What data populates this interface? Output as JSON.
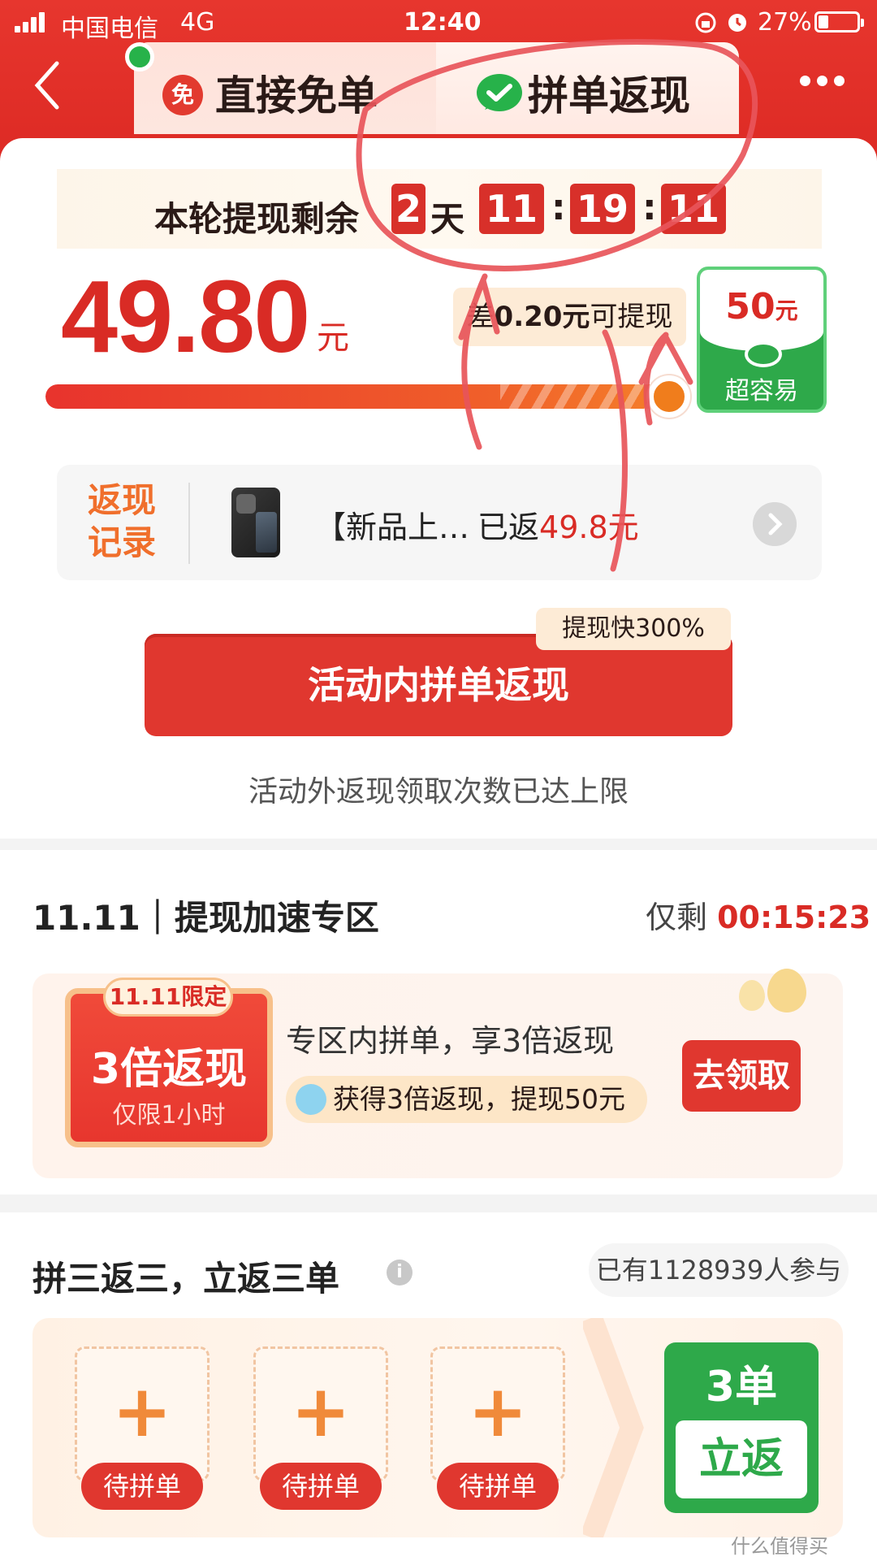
{
  "status_bar": {
    "carrier": "中国电信",
    "network": "4G",
    "time": "12:40",
    "battery": "27%",
    "battery_level": 0.27
  },
  "tabs": [
    {
      "badge": "免",
      "label": "直接免单"
    },
    {
      "label": "拼单返现"
    }
  ],
  "countdown": {
    "prefix": "本轮提现剩余",
    "days": "2",
    "day_unit": "天",
    "hours": "11",
    "minutes": "19",
    "seconds": "11"
  },
  "balance": {
    "amount": "49.80",
    "unit": "元",
    "need_prefix": "差",
    "need_amount": "0.20元",
    "need_suffix": "可提现",
    "target_amount": "50",
    "target_unit": "元",
    "target_sub": "超容易",
    "progress": 0.996
  },
  "record": {
    "title_line1": "返现",
    "title_line2": "记录",
    "product_name": "【新品上…",
    "status_prefix": "已返",
    "status_amount": "49.8元"
  },
  "speed_tip": "提现快300%",
  "main_button": "活动内拼单返现",
  "limit_note": "活动外返现领取次数已达上限",
  "zone": {
    "title": "11.11｜提现加速专区",
    "remain_label": "仅剩",
    "remain_time": "00:15:23",
    "promo_tag": "11.11限定",
    "promo_main": "3倍返现",
    "promo_sub": "仅限1小时",
    "desc": "专区内拼单，享3倍返现",
    "pill": "获得3倍返现，提现50元",
    "button": "去领取"
  },
  "team": {
    "title": "拼三返三，立返三单",
    "count": "已有1128939人参与",
    "slots": [
      "待拼单",
      "待拼单",
      "待拼单"
    ],
    "reward_top": "3单",
    "reward_bottom": "立返"
  },
  "watermark": "什么值得买",
  "colors": {
    "brand_red": "#e0372f",
    "amount_red": "#d92b25",
    "green": "#2ea94a",
    "orange": "#f06f2c",
    "annotation_red": "#e8555a"
  },
  "icons": [
    "signal-icon",
    "alarm-icon",
    "lock-rotation-icon",
    "battery-icon",
    "back-icon",
    "more-icon",
    "wechat-icon",
    "info-icon",
    "chevron-right-icon",
    "plus-icon"
  ]
}
